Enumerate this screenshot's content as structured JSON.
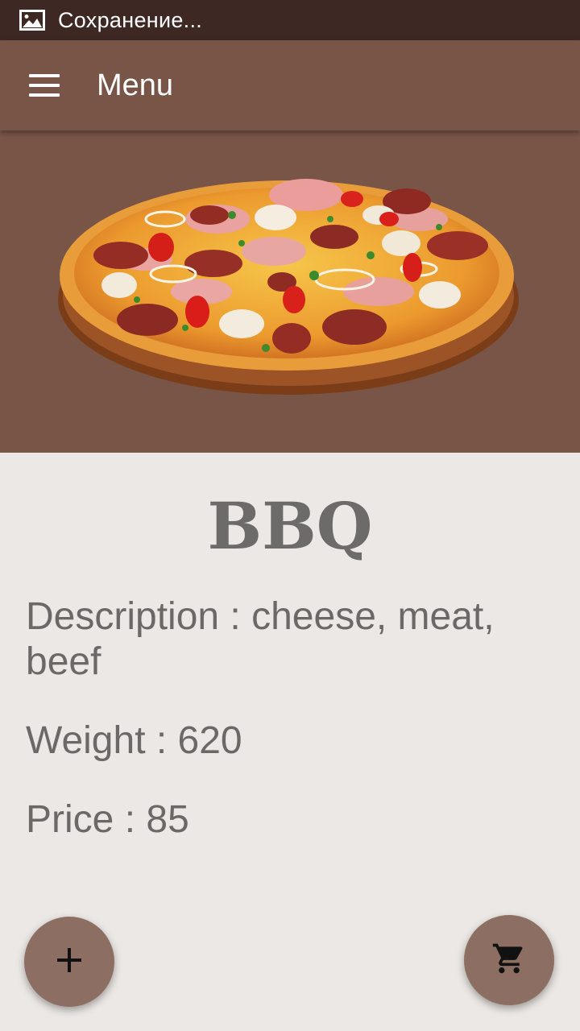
{
  "status_bar": {
    "icon": "image-icon",
    "text": "Сохранение..."
  },
  "app_bar": {
    "menu_icon": "hamburger-menu-icon",
    "title": "Menu"
  },
  "hero": {
    "image": "pizza-photo"
  },
  "item": {
    "name": "BBQ",
    "description": "Description : cheese, meat, beef",
    "weight": "Weight : 620",
    "price": "Price : 85"
  },
  "fabs": {
    "add_icon": "plus-icon",
    "cart_icon": "shopping-cart-icon"
  },
  "colors": {
    "status_bar": "#3d2823",
    "app_bar": "#795548",
    "fab": "#8d6e63",
    "background": "#ece8e5",
    "text": "#6b6867"
  }
}
